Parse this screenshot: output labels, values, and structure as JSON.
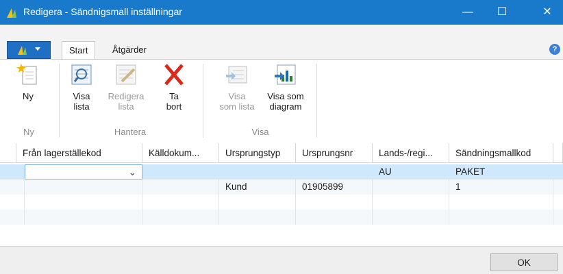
{
  "window": {
    "title": "Redigera - Sändnigsmall inställningar"
  },
  "ribbon": {
    "tabs": [
      {
        "label": "Start"
      },
      {
        "label": "Åtgärder"
      }
    ],
    "groups": [
      {
        "label": "Ny",
        "buttons": [
          {
            "line1": "Ny",
            "line2": "",
            "icon": "new-document-icon",
            "enabled": true
          }
        ]
      },
      {
        "label": "Hantera",
        "buttons": [
          {
            "line1": "Visa",
            "line2": "lista",
            "icon": "view-list-icon",
            "enabled": true
          },
          {
            "line1": "Redigera",
            "line2": "lista",
            "icon": "edit-list-icon",
            "enabled": false
          },
          {
            "line1": "Ta",
            "line2": "bort",
            "icon": "delete-icon",
            "enabled": true
          }
        ]
      },
      {
        "label": "Visa",
        "buttons": [
          {
            "line1": "Visa",
            "line2": "som lista",
            "icon": "show-as-list-icon",
            "enabled": false
          },
          {
            "line1": "Visa som",
            "line2": "diagram",
            "icon": "show-as-chart-icon",
            "enabled": true
          }
        ]
      }
    ]
  },
  "grid": {
    "columns": [
      "Från lagerställekod",
      "Källdokum...",
      "Ursprungstyp",
      "Ursprungsnr",
      "Lands-/regi...",
      "Sändningsmallkod"
    ],
    "rows": [
      {
        "cells": [
          "",
          "",
          "",
          "",
          "AU",
          "PAKET"
        ],
        "selected": true
      },
      {
        "cells": [
          "",
          "",
          "Kund",
          "01905899",
          "",
          "1"
        ],
        "selected": false
      },
      {
        "cells": [
          "",
          "",
          "",
          "",
          "",
          ""
        ],
        "selected": false
      },
      {
        "cells": [
          "",
          "",
          "",
          "",
          "",
          ""
        ],
        "selected": false
      }
    ]
  },
  "footer": {
    "ok_label": "OK"
  },
  "colors": {
    "titlebar": "#1979ca",
    "selected_row": "#cfe8fb",
    "delete_red": "#d92a1c"
  }
}
